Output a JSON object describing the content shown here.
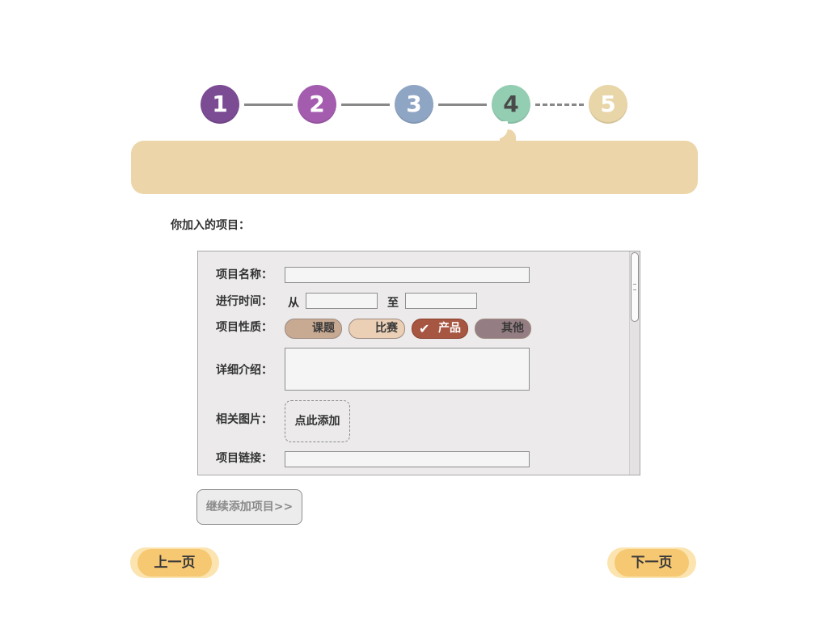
{
  "stepper": {
    "steps": [
      {
        "label": "1",
        "color": "#7b4b94"
      },
      {
        "label": "2",
        "color": "#a35cae"
      },
      {
        "label": "3",
        "color": "#8fa5c4"
      },
      {
        "label": "4",
        "color": "#93cdb2"
      },
      {
        "label": "5",
        "color": "#e8d5a8"
      }
    ],
    "current_step": 4
  },
  "section_title": "你加入的项目：",
  "form": {
    "name_label": "项目名称：",
    "name_value": "",
    "time_label": "进行时间：",
    "time_from": "从",
    "time_to": "至",
    "time_from_value": "",
    "time_to_value": "",
    "nature_label": "项目性质：",
    "nature_options": [
      {
        "label": "课题",
        "selected": false,
        "color": "#c8a992"
      },
      {
        "label": "比赛",
        "selected": false,
        "color": "#ebd0b6"
      },
      {
        "label": "产品",
        "selected": true,
        "color": "#a65641"
      },
      {
        "label": "其他",
        "selected": false,
        "color": "#957e83"
      }
    ],
    "detail_label": "详细介绍：",
    "detail_value": "",
    "image_label": "相关图片：",
    "image_button": "点此添加",
    "link_label": "项目链接：",
    "link_value": ""
  },
  "continue_button": "继续添加项目>>",
  "nav": {
    "prev": "上一页",
    "next": "下一页"
  }
}
